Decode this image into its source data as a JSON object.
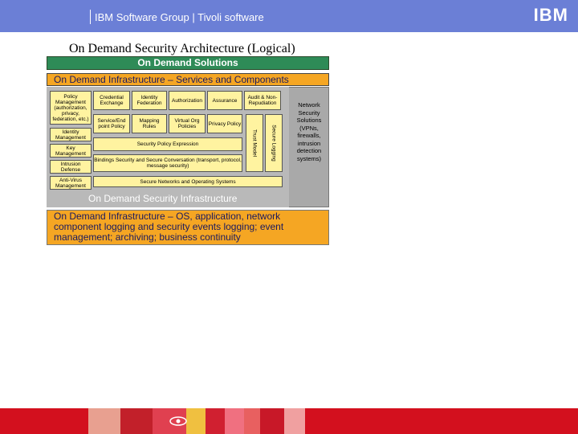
{
  "header": {
    "text": "IBM Software Group | Tivoli software",
    "logo": "IBM",
    "color": "#6b7fd6"
  },
  "title": "On Demand Security Architecture (Logical)",
  "diagram": {
    "solutions": "On Demand Solutions",
    "infra_services": "On Demand Infrastructure – Services and Components",
    "components": {
      "policy_management": "Policy Management (authorization, privacy, federation, etc.)",
      "credential_exchange": "Credential Exchange",
      "identity_federation": "Identity Federation",
      "authorization": "Authorization",
      "assurance": "Assurance",
      "audit": "Audit & Non-Repudiation",
      "service_endpoint_policy": "Service/End point Policy",
      "mapping_rules": "Mapping Rules",
      "virtual_org_policies": "Virtual Org Policies",
      "privacy_policy": "Privacy Policy",
      "identity_management": "Identity Management",
      "key_management": "Key Management",
      "intrusion_defense": "Intrusion Defense",
      "anti_virus": "Anti-Virus Management",
      "security_policy_expression": "Security Policy Expression",
      "bindings": "Bindings Security and Secure Conversation (transport, protocol, message security)",
      "secure_networks": "Secure Networks and Operating Systems",
      "trust_model": "Trust Model",
      "secure_logging": "Secure Logging"
    },
    "security_infrastructure": "On Demand Security Infrastructure",
    "network_security": "Network Security Solutions (VPNs, firewalls, intrusion detection systems)",
    "bottom": "On Demand Infrastructure – OS, application, network component logging and security events logging; event management; archiving; business continuity",
    "colors": {
      "green": "#2e8b57",
      "orange": "#f5a623",
      "yellow": "#fff3a0",
      "gray": "#a9a9a9"
    }
  },
  "footer": {
    "color": "#d3101e",
    "icon": "eye-icon"
  }
}
